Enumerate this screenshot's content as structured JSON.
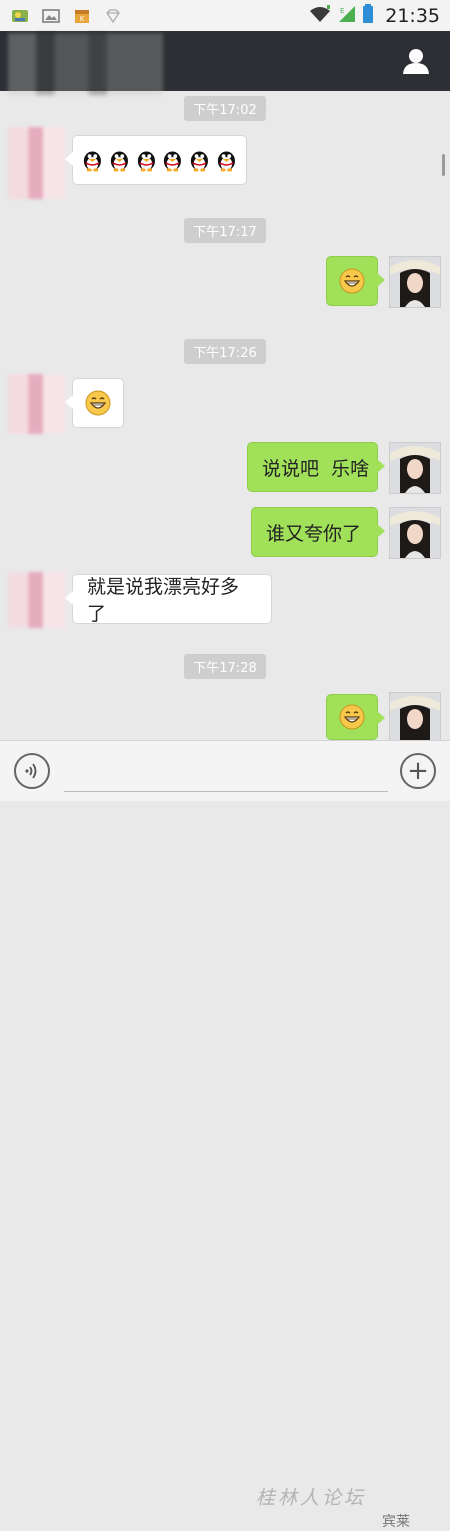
{
  "status_bar": {
    "time": "21:35",
    "left_icons": [
      "gallery-app-icon",
      "image-icon",
      "store-icon",
      "diamond-icon"
    ],
    "right_icons": [
      "wifi-icon",
      "signal-icon",
      "battery-icon"
    ]
  },
  "topbar": {
    "contact_icon": "person-icon"
  },
  "messages": [
    {
      "type": "time",
      "text": "下午17:02"
    },
    {
      "type": "left",
      "content": "penguin-emoji-x6"
    },
    {
      "type": "time",
      "text": "下午17:17"
    },
    {
      "type": "right",
      "content": "grin-emoji"
    },
    {
      "type": "time",
      "text": "下午17:26"
    },
    {
      "type": "left",
      "content": "grin-emoji"
    },
    {
      "type": "right",
      "text": "说说吧  乐啥"
    },
    {
      "type": "right",
      "text": "谁又夸你了"
    },
    {
      "type": "left",
      "text": "就是说我漂亮好多了"
    },
    {
      "type": "time",
      "text": "下午17:28"
    },
    {
      "type": "right",
      "content": "grin-emoji"
    }
  ],
  "input_bar": {
    "placeholder": "",
    "voice_icon": "voice-icon",
    "plus_icon": "plus-icon",
    "plus_label": "+"
  },
  "watermark": {
    "text": "桂林人论坛",
    "sub": "宾莱"
  },
  "colors": {
    "right_bubble": "#a1e15a",
    "left_bubble": "#ffffff",
    "topbar": "#2c2f33",
    "background": "#e9e9e9"
  }
}
